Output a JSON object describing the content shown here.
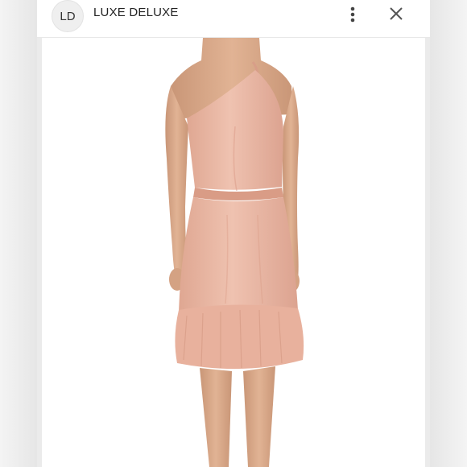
{
  "header": {
    "avatar_initials": "LD",
    "title": "LUXE DELUXE",
    "more_icon": "more-vertical-icon",
    "close_icon": "close-icon"
  },
  "photo": {
    "subject": "dress-back-view",
    "dress_color": "#e9b6a3",
    "skin_color": "#d9a98a",
    "background": "#ffffff"
  }
}
